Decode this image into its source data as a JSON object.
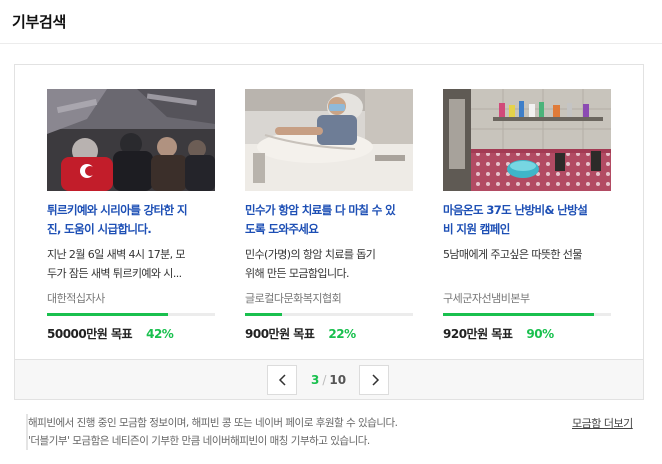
{
  "header": {
    "title": "기부검색"
  },
  "cards": [
    {
      "title": "튀르키예와 시리아를 강타한 지\n진, 도움이 시급합니다.",
      "description": "지난 2월 6일 새벽 4시 17분, 모\n두가 잠든 새벽 튀르키예와 시...",
      "organization": "대한적십자사",
      "goal": "50000만원 목표",
      "percent": "42%",
      "progress": 0.42
    },
    {
      "title": "민수가 항암 치료를 다 마칠 수 있\n도록 도와주세요",
      "description": "민수(가명)의 항암 치료를 돕기\n위해 만든 모금함입니다.",
      "organization": "글로컬다문화복지협회",
      "goal": "900만원 목표",
      "percent": "22%",
      "progress": 0.22
    },
    {
      "title": "마음온도 37도 난방비& 난방설\n비 지원 캠페인",
      "description": "5남매에게 주고싶은 따뜻한 선물",
      "organization": "구세군자선냄비본부",
      "goal": "920만원 목표",
      "percent": "90%",
      "progress": 0.9
    }
  ],
  "pager": {
    "current": "3",
    "separator": "/",
    "total": "10"
  },
  "footer": {
    "line1": "해피빈에서 진행 중인 모금함 정보이며, 해피빈 콩 또는 네이버 페이로 후원할 수 있습니다.",
    "line2": "'더블기부' 모금함은 네티즌이 기부한 만큼 네이버해피빈이 매칭 기부하고 있습니다.",
    "more_link": "모금함 더보기"
  },
  "colors": {
    "accent": "#19c04e",
    "title_link": "#1d4fb5"
  }
}
